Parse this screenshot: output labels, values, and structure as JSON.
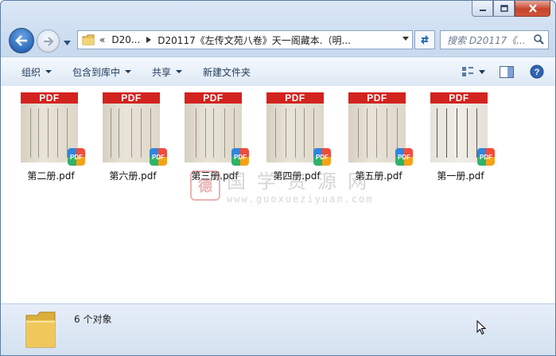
{
  "window": {
    "caption_buttons": {
      "minimize_icon": "minimize-icon",
      "maximize_icon": "maximize-icon",
      "close_icon": "close-icon"
    }
  },
  "address": {
    "breadcrumb_prefix": "«",
    "crumbs": [
      "D20...",
      "D20117《左传文苑八卷》天一阁藏本.（明..."
    ],
    "separator_icon": "chevron-right-icon"
  },
  "search": {
    "placeholder": "搜索 D20117《..."
  },
  "toolbar": {
    "organize": "组织",
    "include_in_library": "包含到库中",
    "share": "共享",
    "new_folder": "新建文件夹"
  },
  "files": [
    {
      "name": "第二册.pdf",
      "banner": "PDF"
    },
    {
      "name": "第六册.pdf",
      "banner": "PDF"
    },
    {
      "name": "第三册.pdf",
      "banner": "PDF"
    },
    {
      "name": "第四册.pdf",
      "banner": "PDF"
    },
    {
      "name": "第五册.pdf",
      "banner": "PDF"
    },
    {
      "name": "第一册.pdf",
      "banner": "PDF"
    }
  ],
  "badge_text": "PDF",
  "watermark": {
    "cn": "国学资源网",
    "url": "www.guoxueziyuan.com",
    "seal": "德"
  },
  "status": {
    "count_text": "6 个对象"
  },
  "colors": {
    "pdf_red": "#d2231f",
    "toolbar_text": "#1e395b",
    "chrome_blue": "#c9daef"
  }
}
